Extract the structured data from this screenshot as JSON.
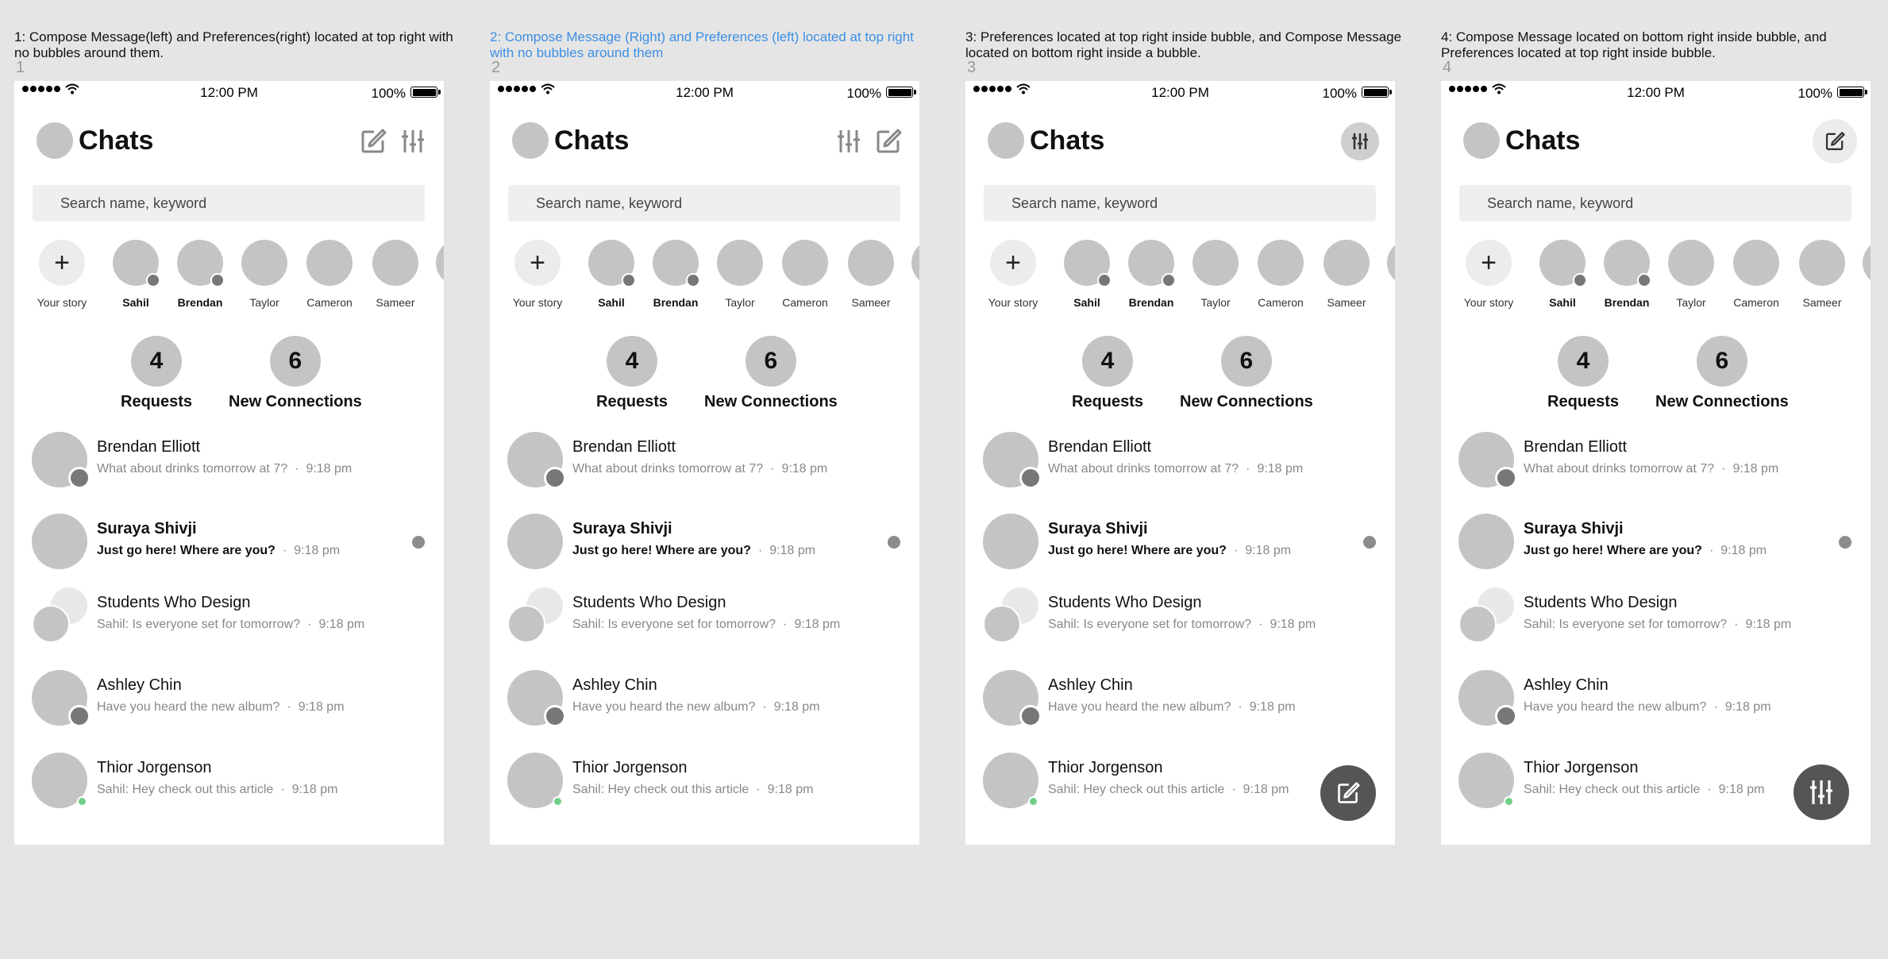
{
  "variants": [
    {
      "caption": "1: Compose Message(left) and Preferences(right) located at top right with no bubbles around them.",
      "number": "1"
    },
    {
      "caption": "2: Compose Message (Right) and Preferences (left) located at top right with no bubbles around them",
      "number": "2"
    },
    {
      "caption": "3: Preferences located at top right inside bubble, and Compose Message located on bottom right inside a bubble.",
      "number": "3"
    },
    {
      "caption": "4: Compose Message located on bottom right inside bubble, and Preferences located at top right inside bubble.",
      "number": "4"
    }
  ],
  "status": {
    "time": "12:00 PM",
    "battery": "100%"
  },
  "header": {
    "title": "Chats"
  },
  "search": {
    "placeholder": "Search name, keyword"
  },
  "stories": [
    {
      "label": "Your story"
    },
    {
      "label": "Sahil"
    },
    {
      "label": "Brendan"
    },
    {
      "label": "Taylor"
    },
    {
      "label": "Cameron"
    },
    {
      "label": "Sameer"
    }
  ],
  "stats": {
    "requests": {
      "count": "4",
      "label": "Requests"
    },
    "connections": {
      "count": "6",
      "label": "New Connections"
    }
  },
  "chats": [
    {
      "name": "Brendan Elliott",
      "message": "What about drinks tomorrow at 7?",
      "time": "9:18 pm"
    },
    {
      "name": "Suraya Shivji",
      "message": "Just go here! Where are you?",
      "time": "9:18 pm"
    },
    {
      "name": "Students Who Design",
      "message": "Sahil: Is everyone set for tomorrow?",
      "time": "9:18 pm"
    },
    {
      "name": "Ashley Chin",
      "message": "Have you heard the new album?",
      "time": "9:18 pm"
    },
    {
      "name": "Thior Jorgenson",
      "message": "Sahil: Hey check out this article",
      "time": "9:18 pm"
    }
  ],
  "icons": {
    "compose": "compose-icon",
    "preferences": "sliders-icon",
    "wifi": "wifi-icon"
  },
  "colors": {
    "caption_highlight": "#3d8fe3",
    "online": "#6fcf87",
    "fab": "#555555"
  }
}
